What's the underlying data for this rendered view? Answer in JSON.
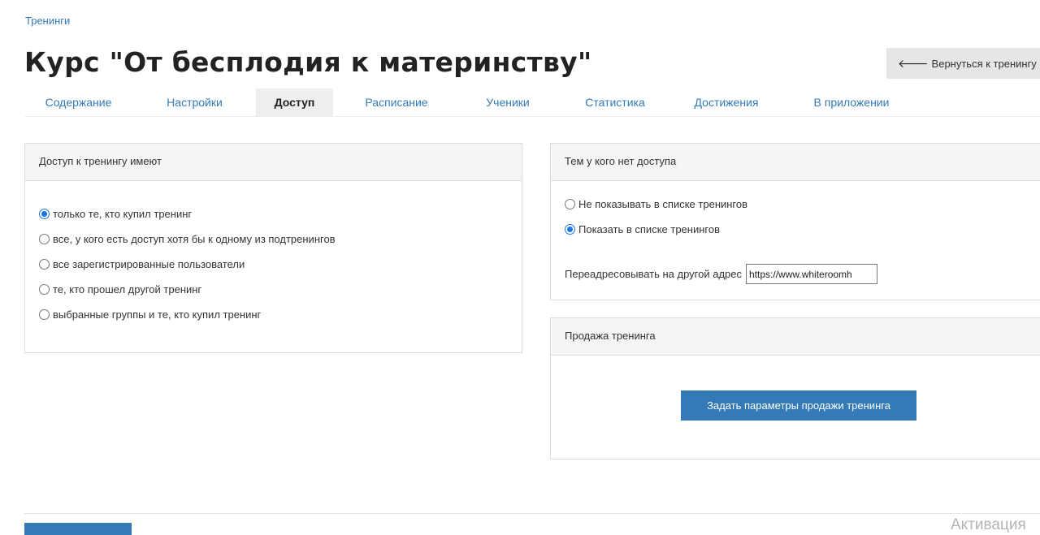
{
  "breadcrumb": "Тренинги",
  "page_title": "Курс \"От бесплодия к материнству\"",
  "back_button": "Вернуться к тренингу",
  "tabs": [
    {
      "label": "Содержание",
      "active": false
    },
    {
      "label": "Настройки",
      "active": false
    },
    {
      "label": "Доступ",
      "active": true
    },
    {
      "label": "Расписание",
      "active": false
    },
    {
      "label": "Ученики",
      "active": false
    },
    {
      "label": "Статистика",
      "active": false
    },
    {
      "label": "Достижения",
      "active": false
    },
    {
      "label": "В приложении",
      "active": false
    }
  ],
  "access_panel": {
    "title": "Доступ к тренингу имеют",
    "options": [
      {
        "label": "только те, кто купил тренинг",
        "checked": true
      },
      {
        "label": "все, у кого есть доступ хотя бы к одному из подтренингов",
        "checked": false
      },
      {
        "label": "все зарегистрированные пользователи",
        "checked": false
      },
      {
        "label": "те, кто прошел другой тренинг",
        "checked": false
      },
      {
        "label": "выбранные группы и те, кто купил тренинг",
        "checked": false
      }
    ]
  },
  "no_access_panel": {
    "title": "Тем у кого нет доступа",
    "options": [
      {
        "label": "Не показывать в списке тренингов",
        "checked": false
      },
      {
        "label": "Показать в списке тренингов",
        "checked": true
      }
    ],
    "redirect_label": "Переадресовывать на другой адрес",
    "redirect_value": "https://www.whiteroomh"
  },
  "sale_panel": {
    "title": "Продажа тренинга",
    "button": "Задать параметры продажи тренинга"
  },
  "watermark": "Активация",
  "colors": {
    "link": "#337ab7",
    "primary_button": "#337ab7",
    "radio_checked": "#1a73e8"
  }
}
